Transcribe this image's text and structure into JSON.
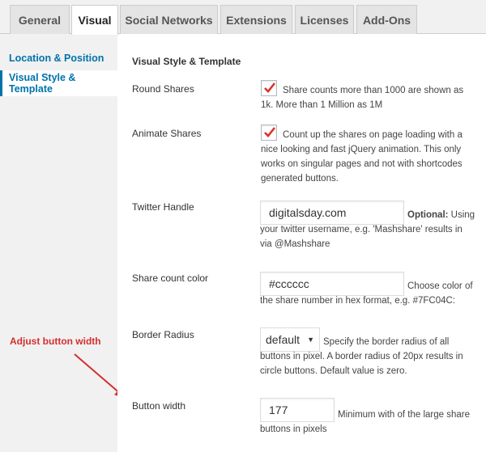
{
  "tabs": [
    {
      "label": "General"
    },
    {
      "label": "Visual",
      "active": true
    },
    {
      "label": "Social Networks"
    },
    {
      "label": "Extensions"
    },
    {
      "label": "Licenses"
    },
    {
      "label": "Add-Ons"
    }
  ],
  "sidebar": {
    "items": [
      {
        "label": "Location & Position"
      },
      {
        "label": "Visual Style & Template",
        "active": true
      }
    ]
  },
  "main": {
    "section_title": "Visual Style & Template",
    "round_shares": {
      "label": "Round Shares",
      "checked": true,
      "desc_line1": "Share counts more than 1000 are shown as",
      "desc_line2": "1k. More than 1 Million as 1M"
    },
    "animate_shares": {
      "label": "Animate Shares",
      "checked": true,
      "desc_line1": "Count up the shares on page loading with a",
      "desc_line2": "nice looking and fast jQuery animation. This only",
      "desc_line3": "works on singular pages and not with shortcodes",
      "desc_line4": "generated buttons."
    },
    "twitter_handle": {
      "label": "Twitter Handle",
      "value": "digitalsday.com",
      "optional_label": "Optional:",
      "desc_first": "Using",
      "desc_line2": "your twitter username, e.g. 'Mashshare' results in",
      "desc_line3": "via @Mashshare"
    },
    "share_count_color": {
      "label": "Share count color",
      "value": "#cccccc",
      "desc_first": "Choose color of",
      "desc_line2": "the share number in hex format, e.g. #7FC04C:"
    },
    "border_radius": {
      "label": "Border Radius",
      "value": "default",
      "desc_first": "Specify the border radius of all",
      "desc_line2": "buttons in pixel. A border radius of 20px results in",
      "desc_line3": "circle buttons. Default value is zero."
    },
    "button_width": {
      "label": "Button width",
      "value": "177",
      "desc_first": "Minimum with of the large share",
      "desc_line2": "buttons in pixels"
    }
  },
  "annotation": {
    "text": "Adjust button width",
    "color": "#d32f2f"
  },
  "colors": {
    "link": "#0073aa",
    "checkmark": "#d9342b"
  }
}
